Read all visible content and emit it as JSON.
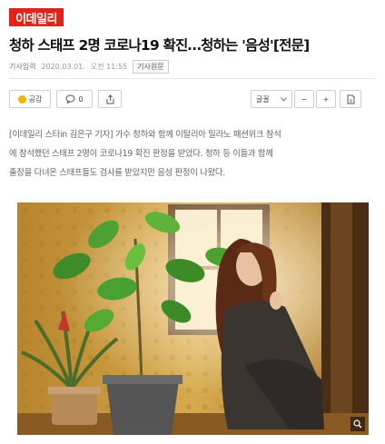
{
  "header": {
    "logo_text": "이데일리"
  },
  "article": {
    "title": "청하 스태프 2명 코로나19 확진…청하는 '음성'[전문]",
    "meta_label": "기사입력",
    "date": "2020.03.01.",
    "time": "오전 11:55",
    "source_tag": "기사원문",
    "paragraph_line1": "[이데일리 스타in 김은구 기자] 가수 청하와 함께 이탈리아 밀라노 패션위크 참석",
    "paragraph_line2": "에 참석했던 스태프 2명이 코로나19 확진 판정을 받았다. 청하 등 이들과 함께",
    "paragraph_line3": "출장을 다녀온 스태프들도 검사를 받았지만 음성 판정이 나왔다."
  },
  "toolbar": {
    "like_label": "공감",
    "comment_count": "0",
    "font_label": "글꼴",
    "minus_label": "−",
    "plus_label": "+"
  },
  "icons": {
    "like": "smile-icon",
    "comment": "comment-icon",
    "share": "share-icon",
    "font": "chevron-down-icon",
    "print": "print-icon",
    "zoom": "zoom-icon"
  },
  "colors": {
    "brand": "#e2231a",
    "photo_bg": "#c89a3e"
  }
}
